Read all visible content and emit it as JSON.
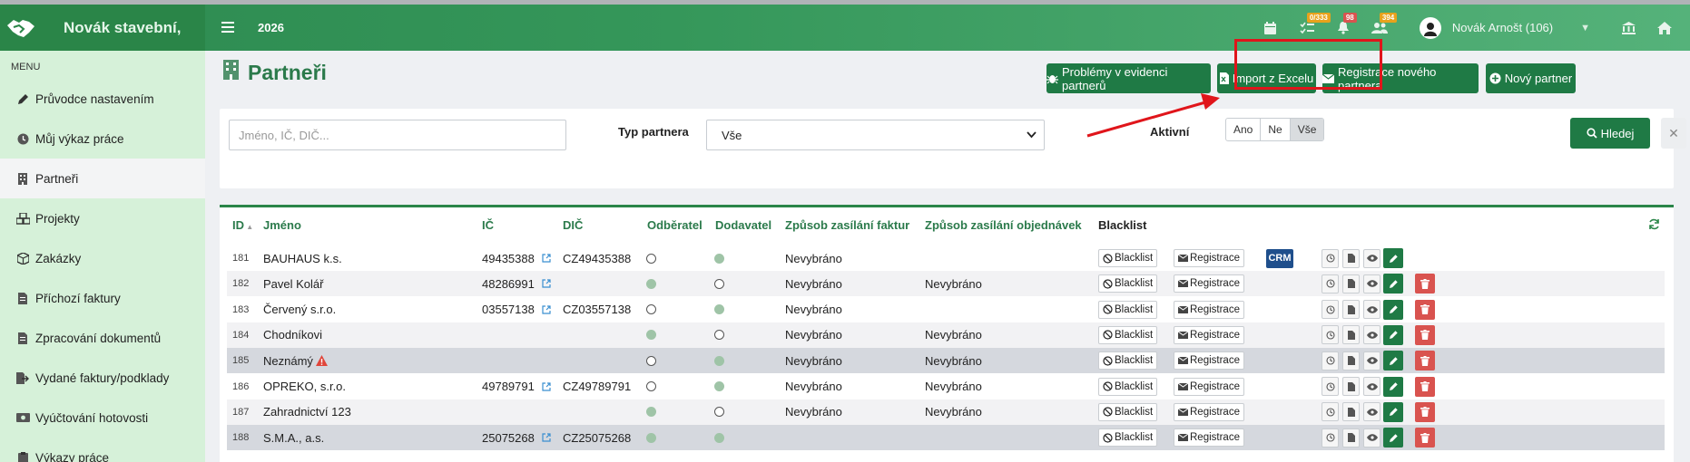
{
  "app": {
    "brand": "Novák stavební,",
    "year": "2026"
  },
  "topbar": {
    "badges": [
      {
        "icon": "calendar-icon",
        "text": ""
      },
      {
        "icon": "tasks-icon",
        "text": "0/333",
        "color": "#e8a21c"
      },
      {
        "icon": "bell-icon",
        "text": "98",
        "color": "#d9534f"
      },
      {
        "icon": "users-icon",
        "text": "394",
        "color": "#e8a21c"
      }
    ],
    "user": "Novák Arnošt (106)"
  },
  "sidebar": {
    "title": "MENU",
    "items": [
      {
        "label": "Průvodce nastavením",
        "icon": "pencil-icon"
      },
      {
        "label": "Můj výkaz práce",
        "icon": "clock-icon"
      },
      {
        "label": "Partneři",
        "icon": "building-icon"
      },
      {
        "label": "Projekty",
        "icon": "cubes-icon"
      },
      {
        "label": "Zakázky",
        "icon": "box-icon"
      },
      {
        "label": "Příchozí faktury",
        "icon": "file-icon"
      },
      {
        "label": "Zpracování dokumentů",
        "icon": "file-text-icon"
      },
      {
        "label": "Vydané faktury/podklady",
        "icon": "export-icon"
      },
      {
        "label": "Vyúčtování hotovosti",
        "icon": "cash-icon"
      },
      {
        "label": "Výkazy práce",
        "icon": "clipboard-icon"
      }
    ]
  },
  "page": {
    "title": "Partneři",
    "buttons": {
      "problems": "Problémy v evidenci partnerů",
      "import": "Import z Excelu",
      "register": "Registrace nového partnera",
      "new": "Nový partner"
    }
  },
  "filters": {
    "name_placeholder": "Jméno, IČ, DIČ...",
    "type_label": "Typ partnera",
    "type_value": "Vše",
    "active_label": "Aktivní",
    "active_options": [
      "Ano",
      "Ne",
      "Vše"
    ],
    "active_selected": "Vše",
    "search_label": "Hledej"
  },
  "table": {
    "headers": {
      "id": "ID",
      "name": "Jméno",
      "ic": "IČ",
      "dic": "DIČ",
      "customer": "Odběratel",
      "supplier": "Dodavatel",
      "invoice_delivery": "Způsob zasílání faktur",
      "order_delivery": "Způsob zasílání objednávek",
      "blacklist": "Blacklist"
    },
    "action_labels": {
      "blacklist": "Blacklist",
      "registration": "Registrace",
      "crm": "CRM"
    },
    "rows": [
      {
        "id": "181",
        "name": "BAUHAUS k.s.",
        "ic": "49435388",
        "dic": "CZ49435388",
        "customer": false,
        "supplier": true,
        "invoice": "Nevybráno",
        "order": "",
        "crm": true,
        "delete": false,
        "warning": false
      },
      {
        "id": "182",
        "name": "Pavel Kolář",
        "ic": "48286991",
        "dic": "",
        "customer": true,
        "supplier": false,
        "invoice": "Nevybráno",
        "order": "Nevybráno",
        "crm": false,
        "delete": true,
        "warning": false
      },
      {
        "id": "183",
        "name": "Červený s.r.o.",
        "ic": "03557138",
        "dic": "CZ03557138",
        "customer": false,
        "supplier": true,
        "invoice": "Nevybráno",
        "order": "",
        "crm": false,
        "delete": true,
        "warning": false
      },
      {
        "id": "184",
        "name": "Chodníkovi",
        "ic": "",
        "dic": "",
        "customer": true,
        "supplier": false,
        "invoice": "Nevybráno",
        "order": "Nevybráno",
        "crm": false,
        "delete": true,
        "warning": false
      },
      {
        "id": "185",
        "name": "Neznámý",
        "ic": "",
        "dic": "",
        "customer": false,
        "supplier": true,
        "invoice": "Nevybráno",
        "order": "Nevybráno",
        "crm": false,
        "delete": true,
        "warning": true
      },
      {
        "id": "186",
        "name": "OPREKO, s.r.o.",
        "ic": "49789791",
        "dic": "CZ49789791",
        "customer": false,
        "supplier": true,
        "invoice": "Nevybráno",
        "order": "Nevybráno",
        "crm": false,
        "delete": true,
        "warning": false
      },
      {
        "id": "187",
        "name": "Zahradnictví 123",
        "ic": "",
        "dic": "",
        "customer": true,
        "supplier": false,
        "invoice": "Nevybráno",
        "order": "Nevybráno",
        "crm": false,
        "delete": true,
        "warning": false
      },
      {
        "id": "188",
        "name": "S.M.A., a.s.",
        "ic": "25075268",
        "dic": "CZ25075268",
        "customer": true,
        "supplier": true,
        "invoice": "",
        "order": "",
        "crm": false,
        "delete": true,
        "warning": false
      }
    ]
  },
  "colors": {
    "brand_green": "#2a8548",
    "button_green": "#1f7a45",
    "sidebar_bg": "#d6f1d9",
    "delete_red": "#d9534f",
    "crm_blue": "#1f4f8c",
    "annotation_red": "#e0151b"
  }
}
